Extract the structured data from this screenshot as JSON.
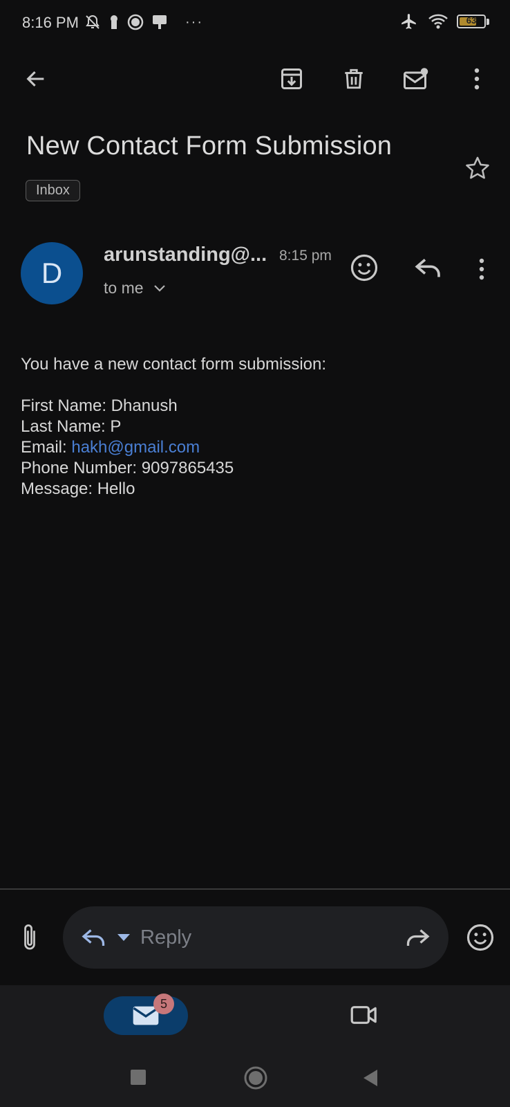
{
  "status_bar": {
    "time": "8:16 PM",
    "battery": "63",
    "more": "···"
  },
  "toolbar": {
    "back_icon": "arrow-back-icon",
    "archive_icon": "archive-icon",
    "delete_icon": "trash-icon",
    "mark_unread_icon": "mark-unread-icon",
    "more_icon": "more-vert-icon"
  },
  "email": {
    "subject": "New Contact Form Submission",
    "label": "Inbox",
    "avatar_letter": "D",
    "sender": "arunstanding@...",
    "time": "8:15 pm",
    "recipient": "to me",
    "intro": "You have a new contact form submission:",
    "first_name": "First Name: Dhanush",
    "last_name": "Last Name: P",
    "email_label": "Email: ",
    "email_value": "hakh@gmail.com",
    "phone": "Phone Number: 9097865435",
    "message": "Message: Hello"
  },
  "reply_bar": {
    "placeholder": "Reply"
  },
  "bottom_nav": {
    "mail_badge": "5"
  },
  "colors": {
    "background": "#0e0e0f",
    "accent": "#0b4f8f",
    "link": "#4a7fd4"
  }
}
